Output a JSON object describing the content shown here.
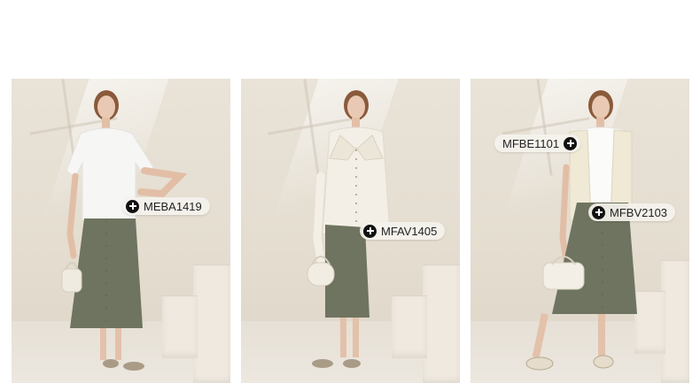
{
  "colors": {
    "background": "#ffffff",
    "tag_bg": "#f5f2ed",
    "plus_icon": "#111111"
  },
  "looks": [
    {
      "name": "look-1",
      "tags": [
        {
          "code": "MEBA1419",
          "icon": "plus-icon",
          "icon_side": "left"
        }
      ]
    },
    {
      "name": "look-2",
      "tags": [
        {
          "code": "MFAV1405",
          "icon": "plus-icon",
          "icon_side": "left"
        }
      ]
    },
    {
      "name": "look-3",
      "tags": [
        {
          "code": "MFBE1101",
          "icon": "plus-icon",
          "icon_side": "right"
        },
        {
          "code": "MFBV2103",
          "icon": "plus-icon",
          "icon_side": "left"
        }
      ]
    }
  ]
}
